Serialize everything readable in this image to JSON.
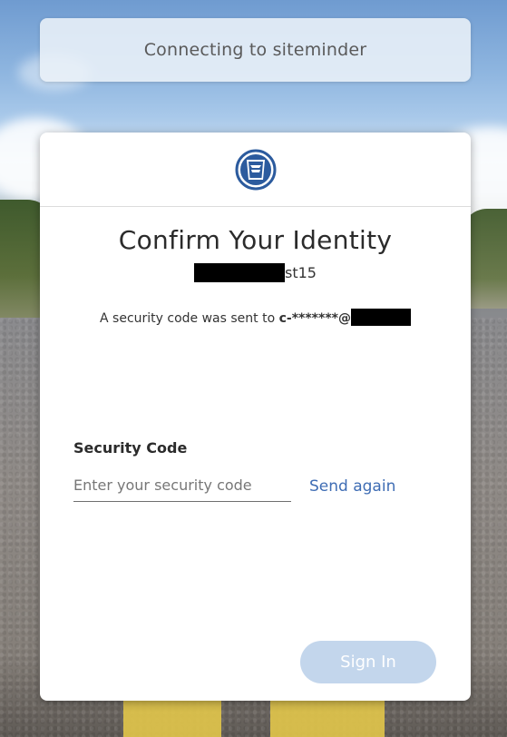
{
  "banner": {
    "text": "Connecting to siteminder"
  },
  "card": {
    "logo_icon": "keystone-seal-icon",
    "title": "Confirm Your Identity",
    "username_suffix": "st15",
    "sent_message_prefix": "A security code was sent to ",
    "sent_message_masked": "c-*******@"
  },
  "form": {
    "security_code_label": "Security Code",
    "security_code_placeholder": "Enter your security code",
    "security_code_value": "",
    "send_again_label": "Send again",
    "sign_in_label": "Sign In"
  },
  "colors": {
    "link": "#3f6db4",
    "button_disabled": "#c3d6ec",
    "logo_blue": "#2c5b9e"
  }
}
